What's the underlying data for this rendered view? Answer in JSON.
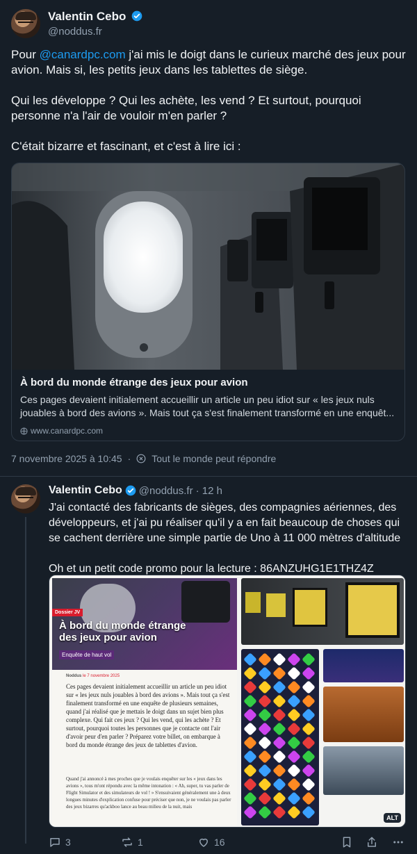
{
  "main_post": {
    "author": "Valentin Cebo",
    "handle": "@noddus.fr",
    "text_pre": "Pour ",
    "mention": "@canardpc.com",
    "text_post": " j'ai mis le doigt dans le curieux marché des jeux pour avion. Mais si, les petits jeux dans les tablettes de siège.\n\nQui les développe ? Qui les achète, les vend ? Et surtout, pourquoi personne n'a l'air de vouloir m'en parler ?\n\nC'était bizarre et fascinant, et c'est à lire ici :",
    "link_card": {
      "title": "À bord du monde étrange des jeux pour avion",
      "description": "Ces pages devaient initialement accueillir un article un peu idiot sur « les jeux nuls jouables à bord des avions ». Mais tout ça s'est finalement transformé en une enquêt...",
      "domain": "www.canardpc.com"
    },
    "timestamp": "7 novembre 2025 à 10:45",
    "reply_setting": "Tout le monde peut répondre"
  },
  "reply_post": {
    "author": "Valentin Cebo",
    "handle": "@noddus.fr",
    "time": "· 12 h",
    "text": "J'ai contacté des fabricants de sièges, des compagnies aériennes, des développeurs, et j'ai pu réaliser qu'il y a en fait beaucoup de choses qui se cachent derrière une simple partie de Uno à 11 000 mètres d'altitude\n\nOh et un petit code promo pour la lecture : 86ANZUHG1E1THZ4Z",
    "media": {
      "tag": "Dossier JV",
      "headline_1": "À bord du monde étrange",
      "headline_2": "des jeux pour avion",
      "subtitle": "Enquête de haut vol",
      "byline_author": "Noddus",
      "byline_date": "le 7 novembre 2025",
      "lead": "Ces pages devaient initialement accueillir un article un peu idiot sur « les jeux nuls jouables à bord des avions ». Mais tout ça s'est finalement transformé en une enquête de plusieurs semaines, quand j'ai réalisé que je mettais le doigt dans un sujet bien plus complexe. Qui fait ces jeux ? Qui les vend, qui les achète ? Et surtout, pourquoi toutes les personnes que je contacte ont l'air d'avoir peur d'en parler ? Préparez votre billet, on embarque à bord du monde étrange des jeux de tablettes d'avion.",
      "body": "Quand j'ai annoncé à mes proches que je voulais enquêter sur les « jeux dans les avions », tous m'ont répondu avec la même intonation : « Ah, super, tu vas parler de Flight Simulator et des simulateurs de vol ! » S'ensuivaient généralement une à deux longues minutes d'explication confuse pour préciser que non, je ne voulais pas parler des jeux bizarres qu'ackboo lance au beau milieu de la nuit, mais",
      "alt": "ALT"
    },
    "actions": {
      "replies": "3",
      "reposts": "1",
      "likes": "16"
    }
  },
  "colors": {
    "background": "#161e27",
    "accent": "#1d9bf0",
    "muted": "#93a1b0"
  }
}
